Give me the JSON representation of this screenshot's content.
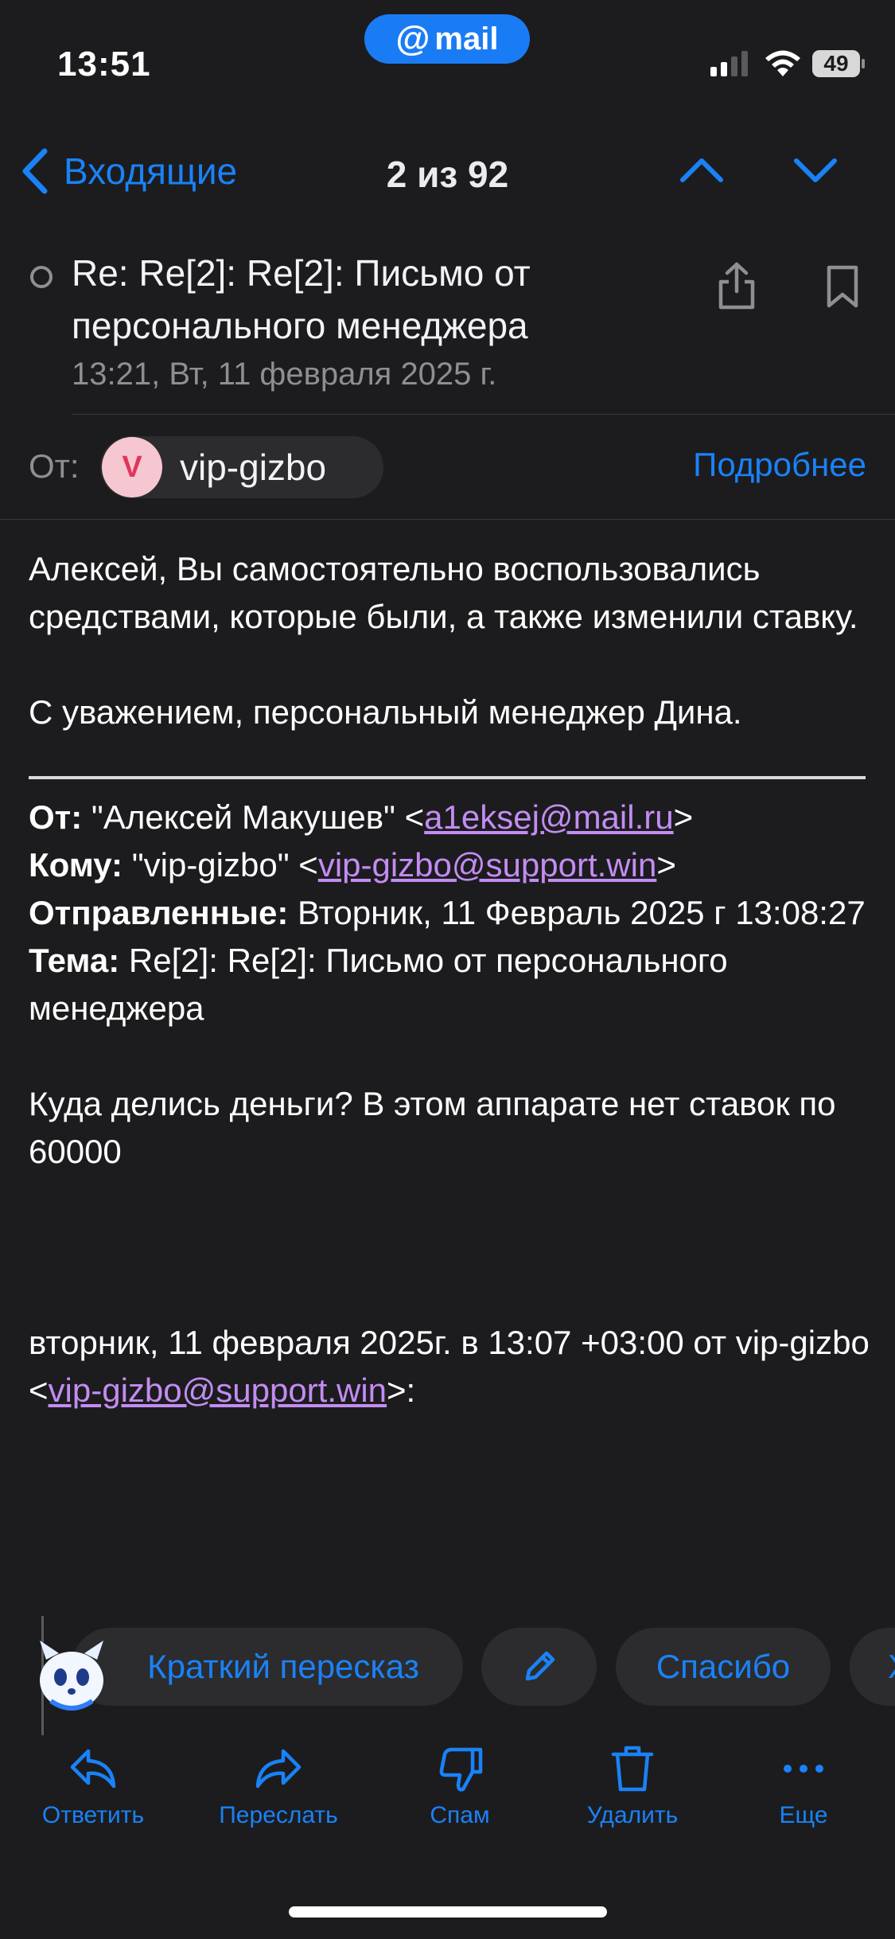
{
  "status_bar": {
    "time": "13:51",
    "battery": "49",
    "app_badge": "mail",
    "app_badge_at": "@"
  },
  "nav": {
    "back_label": "Входящие",
    "counter": "2 из 92"
  },
  "message": {
    "subject": "Re: Re[2]: Re[2]: Письмо от персонального менеджера",
    "date": "13:21, Вт, 11 февраля 2025 г.",
    "from_label": "От:",
    "sender_initial": "V",
    "sender_name": "vip-gizbo",
    "details_link": "Подробнее"
  },
  "body": {
    "para1": "Алексей, Вы самостоятельно воспользовались средствами, которые были, а также изменили ставку.",
    "para2": "С уважением, персональный менеджер Дина.",
    "quoted_header": {
      "from_label": "От:",
      "from_name": " \"Алексей Макушев\" <",
      "from_email": "a1eksej@mail.ru",
      "from_close": ">",
      "to_label": "Кому:",
      "to_name": " \"vip-gizbo\" <",
      "to_email": "vip-gizbo@support.win",
      "to_close": ">",
      "sent_label": "Отправленные:",
      "sent_value": " Вторник, 11 Февраль 2025 г 13:08:27",
      "subject_label": "Тема:",
      "subject_value": " Re[2]: Re[2]: Письмо от персонального менеджера"
    },
    "quoted_text": "Куда делись деньги? В этом аппарате нет ставок по 60000",
    "reply_line_prefix": "вторник, 11 февраля 2025г. в 13:07 +03:00 от vip-gizbo <",
    "reply_line_email": "vip-gizbo@support.win",
    "reply_line_suffix": ">:"
  },
  "suggestions": {
    "summary": "Краткий пересказ",
    "thanks": "Спасибо",
    "more": "Х"
  },
  "toolbar": {
    "reply": "Ответить",
    "forward": "Переслать",
    "spam": "Спам",
    "delete": "Удалить",
    "more": "Еще"
  },
  "colors": {
    "accent": "#1a82f7",
    "background": "#1c1c1e",
    "link": "#c38cf2",
    "avatar_bg": "#f7c7d1",
    "avatar_fg": "#e0365b"
  }
}
